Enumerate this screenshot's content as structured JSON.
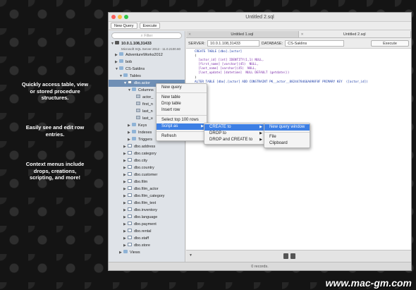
{
  "promo": {
    "p1": [
      "Quickly access table, view",
      "or stored procedure",
      "structures."
    ],
    "p2": [
      "Easily see and edit row",
      "entries."
    ],
    "p3": [
      "Context menus include",
      "drops, creations,",
      "scripting, and more!"
    ]
  },
  "watermark": "www.mac-gm.com",
  "window": {
    "title": "Untitled 2.sql"
  },
  "toolbar": {
    "new_query": "New Query",
    "execute": "Execute"
  },
  "sidebar": {
    "filter_placeholder": "Filter",
    "server": "10.0.1.108,31433",
    "server_sub": "Microsoft SQL Server 2012 - 11.0.2100.60",
    "items": [
      "AdventureWorks2012",
      "bob",
      "CS-Saklins",
      "Tables",
      "dbo.actor",
      "Columns",
      "actor_",
      "first_n",
      "last_n",
      "last_u",
      "Keys",
      "Indexes",
      "Triggers",
      "dbo.address",
      "dbo.category",
      "dbo.city",
      "dbo.country",
      "dbo.customer",
      "dbo.film",
      "dbo.film_actor",
      "dbo.film_category",
      "dbo.film_text",
      "dbo.inventory",
      "dbo.language",
      "dbo.payment",
      "dbo.rental",
      "dbo.staff",
      "dbo.store",
      "Views"
    ]
  },
  "tabs": [
    "Untitled 1.sql",
    "Untitled 2.sql"
  ],
  "query_bar": {
    "server_label": "SERVER:",
    "server_value": "10.0.1.108,31433",
    "database_label": "DATABASE:",
    "database_value": "CS-Saklins",
    "execute": "Execute"
  },
  "editor": {
    "lines": [
      "CREATE TABLE [dbo].[actor]",
      "(",
      "  [actor_id] [int] IDENTITY(1,1) NULL,",
      "  [first_name] [varchar](45)  NULL,",
      "  [last_name] [varchar](45)  NULL,",
      "  [last_update] [datetime]  NULL DEFAULT (getdate())",
      ")",
      "ALTER TABLE [dbo].[actor] ADD CONSTRAINT PK__actor__8824478466A898F8F PRIMARY KEY  ([actor_id])"
    ]
  },
  "status": "0 records.",
  "context_menu": {
    "items": [
      "New query",
      "New table",
      "Drop table",
      "Insert row",
      "Select top 100 rows",
      "Script as",
      "Refresh"
    ]
  },
  "script_menu": {
    "items": [
      "CREATE to",
      "DROP to",
      "DROP and CREATE to"
    ]
  },
  "create_menu": {
    "items": [
      "New query window",
      "File",
      "Clipboard"
    ]
  },
  "colors": {
    "selection": "#6f8fb5",
    "menu_highlight": "#3d7fe4",
    "sidebar_bg": "#dfe3e8"
  }
}
